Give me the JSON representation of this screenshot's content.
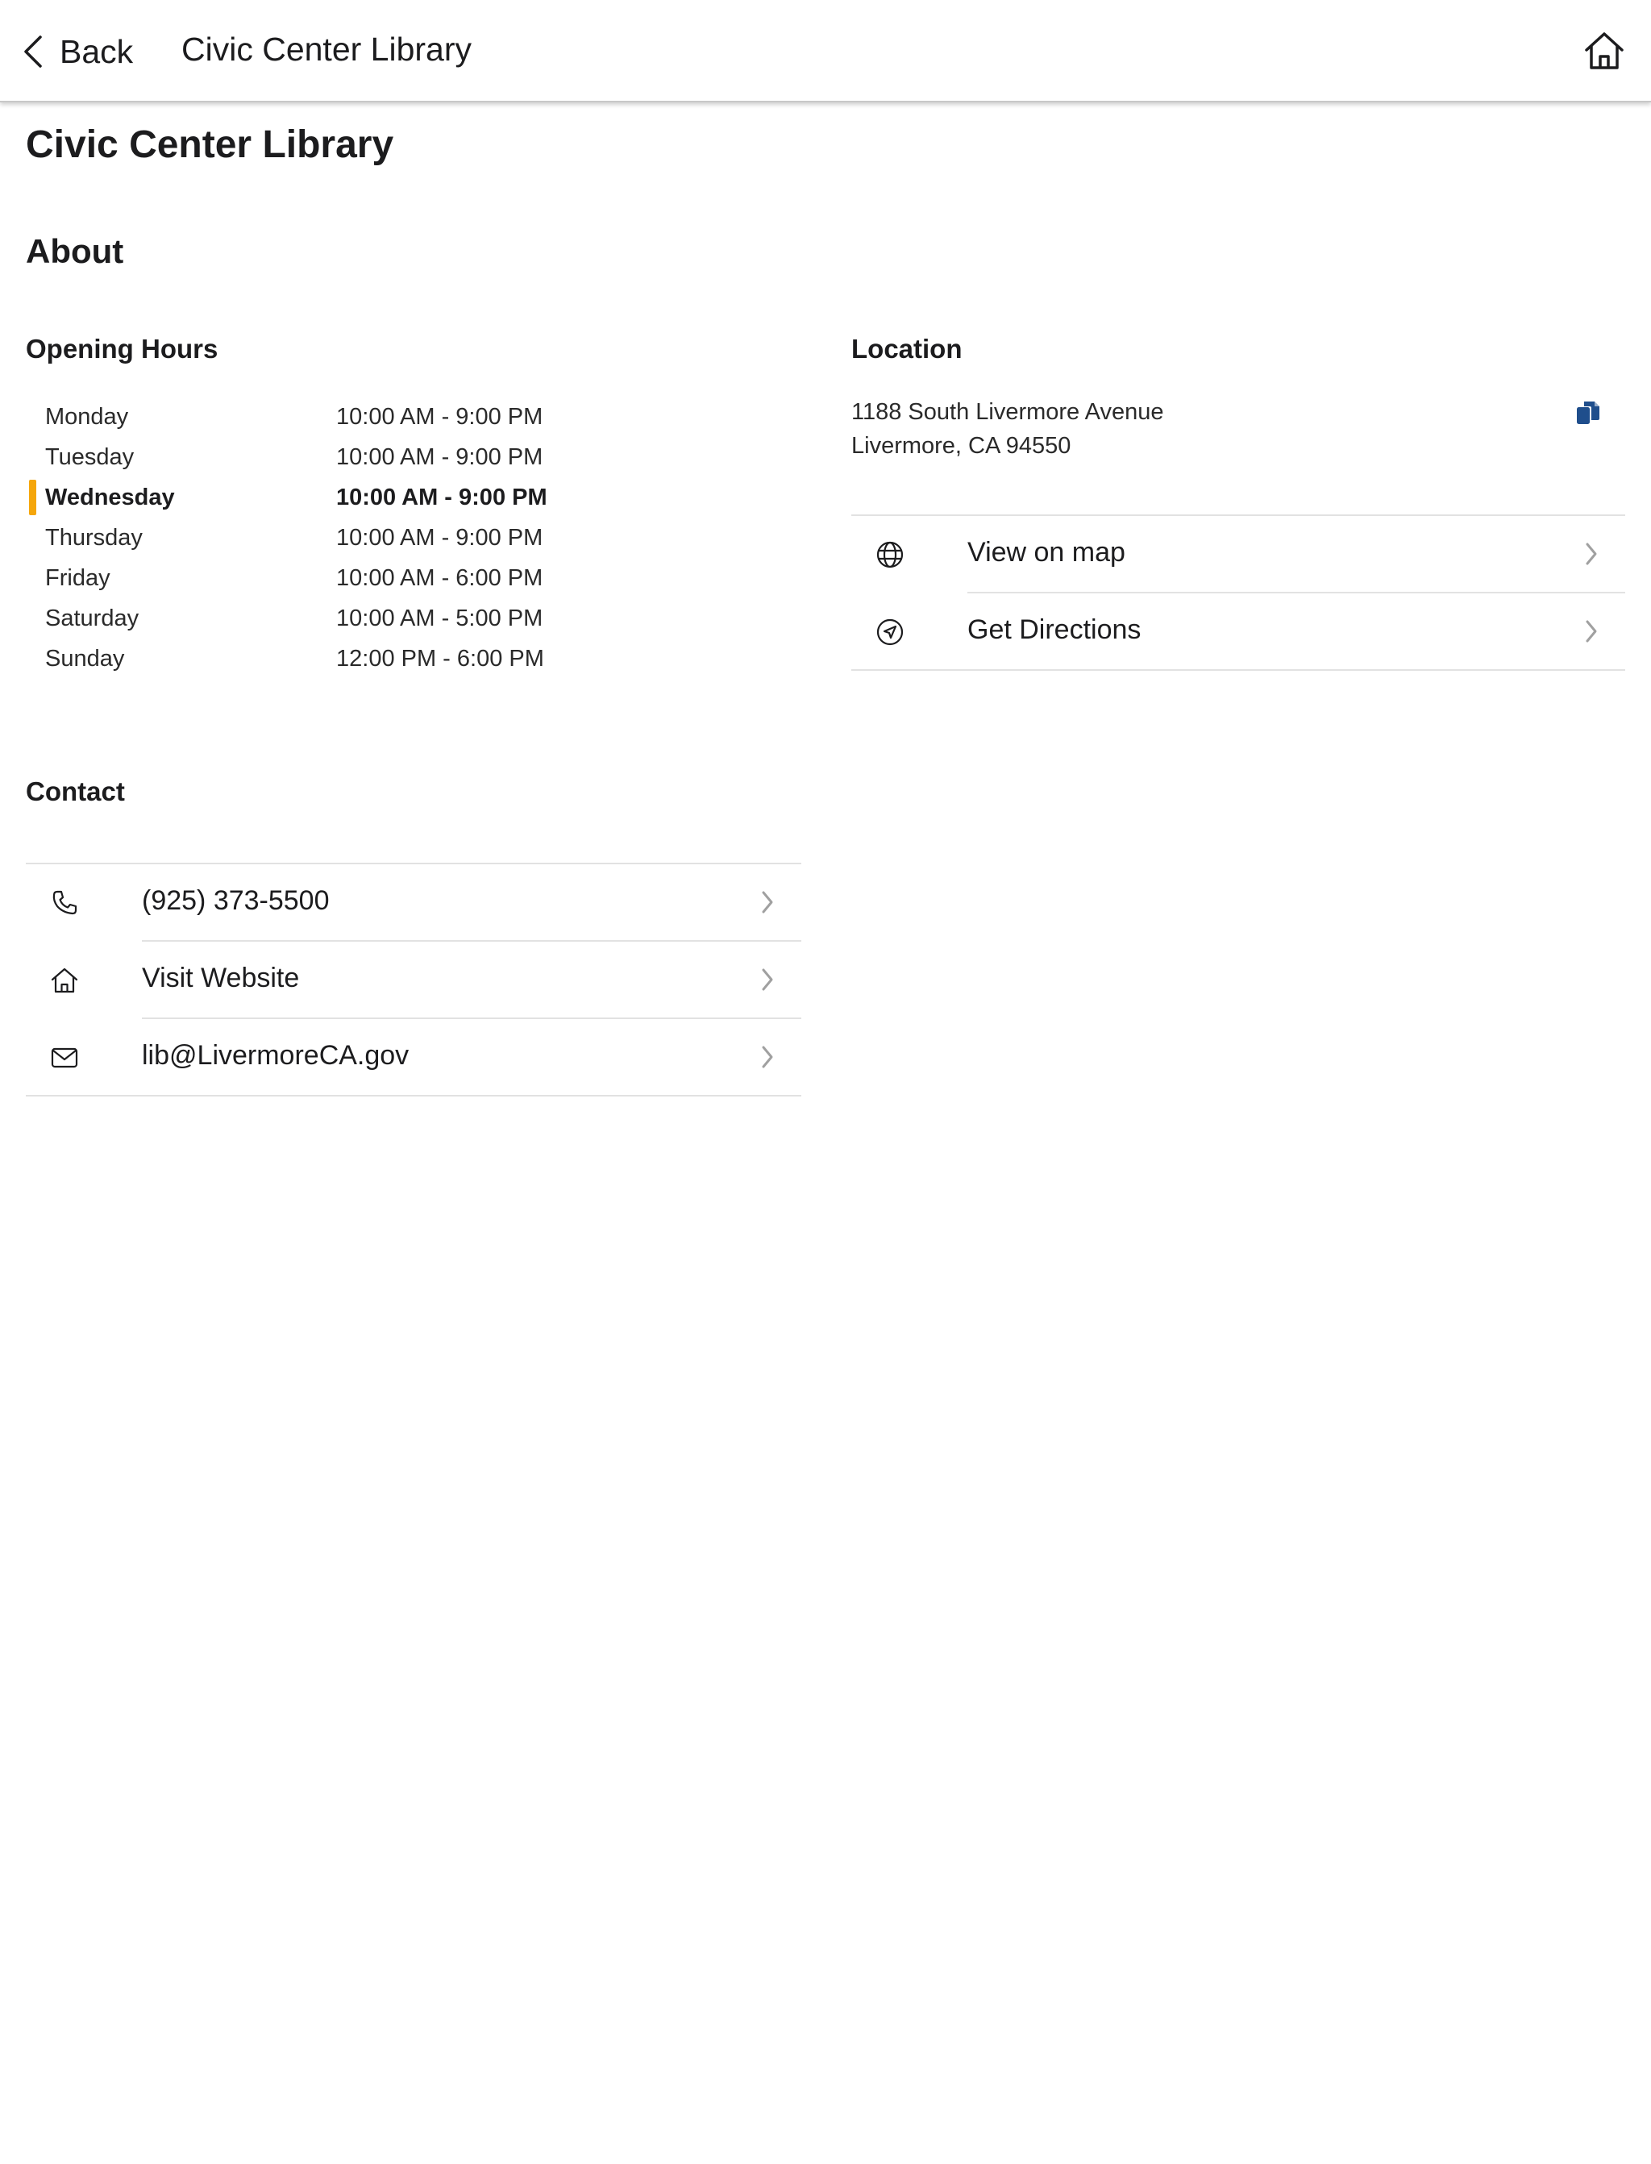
{
  "nav": {
    "back_label": "Back",
    "title": "Civic Center Library",
    "back_icon": "chevron-left-icon",
    "home_icon": "home-icon"
  },
  "page": {
    "title": "Civic Center Library",
    "about_heading": "About"
  },
  "hours": {
    "heading": "Opening Hours",
    "today_accent": "#f5a60b",
    "rows": [
      {
        "day": "Monday",
        "time": "10:00 AM - 9:00 PM"
      },
      {
        "day": "Tuesday",
        "time": "10:00 AM - 9:00 PM"
      },
      {
        "day": "Wednesday",
        "time": "10:00 AM - 9:00 PM",
        "today": true
      },
      {
        "day": "Thursday",
        "time": "10:00 AM - 9:00 PM"
      },
      {
        "day": "Friday",
        "time": "10:00 AM - 6:00 PM"
      },
      {
        "day": "Saturday",
        "time": "10:00 AM - 5:00 PM"
      },
      {
        "day": "Sunday",
        "time": "12:00 PM - 6:00 PM"
      }
    ]
  },
  "location": {
    "heading": "Location",
    "address_line1": "1188 South Livermore Avenue",
    "address_line2": "Livermore, CA 94550",
    "copy_icon": "copy-icon",
    "copy_icon_color": "#1f4e8c",
    "actions": [
      {
        "label": "View on map",
        "icon": "globe-icon"
      },
      {
        "label": "Get Directions",
        "icon": "navigation-arrow-icon"
      }
    ]
  },
  "contact": {
    "heading": "Contact",
    "items": [
      {
        "label": "(925) 373-5500",
        "icon": "phone-icon"
      },
      {
        "label": "Visit Website",
        "icon": "home-icon"
      },
      {
        "label": "lib@LivermoreCA.gov",
        "icon": "mail-icon"
      }
    ]
  }
}
